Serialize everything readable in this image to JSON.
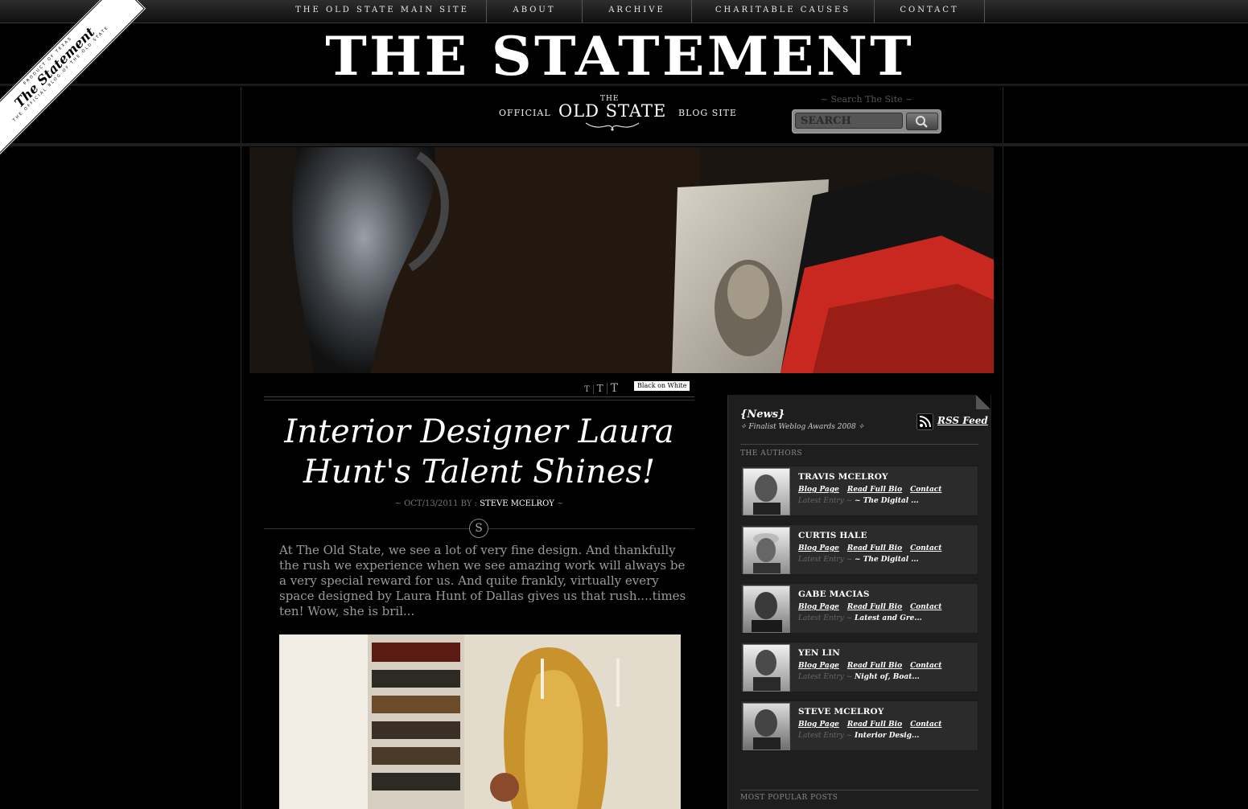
{
  "nav": {
    "items": [
      "The Old State Main Site",
      "About",
      "Archive",
      "Charitable Causes",
      "Contact"
    ]
  },
  "corner_badge": {
    "line1": "PRODUCT OF TEXAS",
    "line2": "The Statement",
    "line3": "THE OFFICIAL BLOG OF THE OLD STATE"
  },
  "masthead": {
    "title": "THE STATEMENT",
    "tag_left": "OFFICIAL",
    "logo_the": "THE",
    "logo_name": "OLD STATE",
    "tag_right": "BLOG SITE"
  },
  "search": {
    "caption": "~ Search The Site ~",
    "placeholder": "SEARCH"
  },
  "text_controls": {
    "small": "T",
    "medium": "T",
    "large": "T",
    "mode_button": "Black on White"
  },
  "post": {
    "title": "Interior Designer Laura Hunt's Talent Shines!",
    "meta_prefix": "~ OCT/13/2011 BY :",
    "author": "STEVE MCELROY",
    "meta_suffix": "~",
    "emblem": "S",
    "excerpt": "At The Old State, we see a lot of very fine design.  And thankfully the rush we experience when we see amazing work will always be a very special reward for us. And quite frankly, virtually every space designed by Laura Hunt of Dallas gives us that rush....times ten!  Wow, she is bril..."
  },
  "sidebar": {
    "news_title": "{News}",
    "news_sub": "✧ Finalist Weblog Awards 2008 ✧",
    "rss_label": "RSS Feed",
    "authors_heading": "THE AUTHORS",
    "link_blog": "Blog Page",
    "link_bio": "Read Full Bio",
    "link_contact": "Contact",
    "latest_label": "Latest Entry ~",
    "authors": [
      {
        "name": "TRAVIS MCELROY",
        "latest": "~ The Digital ..."
      },
      {
        "name": "CURTIS HALE",
        "latest": "~ The Digital ..."
      },
      {
        "name": "GABE MACIAS",
        "latest": "Latest and Gre..."
      },
      {
        "name": "YEN LIN",
        "latest": "Night of, Boat..."
      },
      {
        "name": "STEVE MCELROY",
        "latest": "Interior Desig..."
      }
    ],
    "popular_heading": "MOST POPULAR POSTS"
  },
  "colors": {
    "background": "#000000",
    "sidebar": "#1e1e1e",
    "card": "#2b2b2b",
    "text_muted": "#9a9a9a"
  }
}
